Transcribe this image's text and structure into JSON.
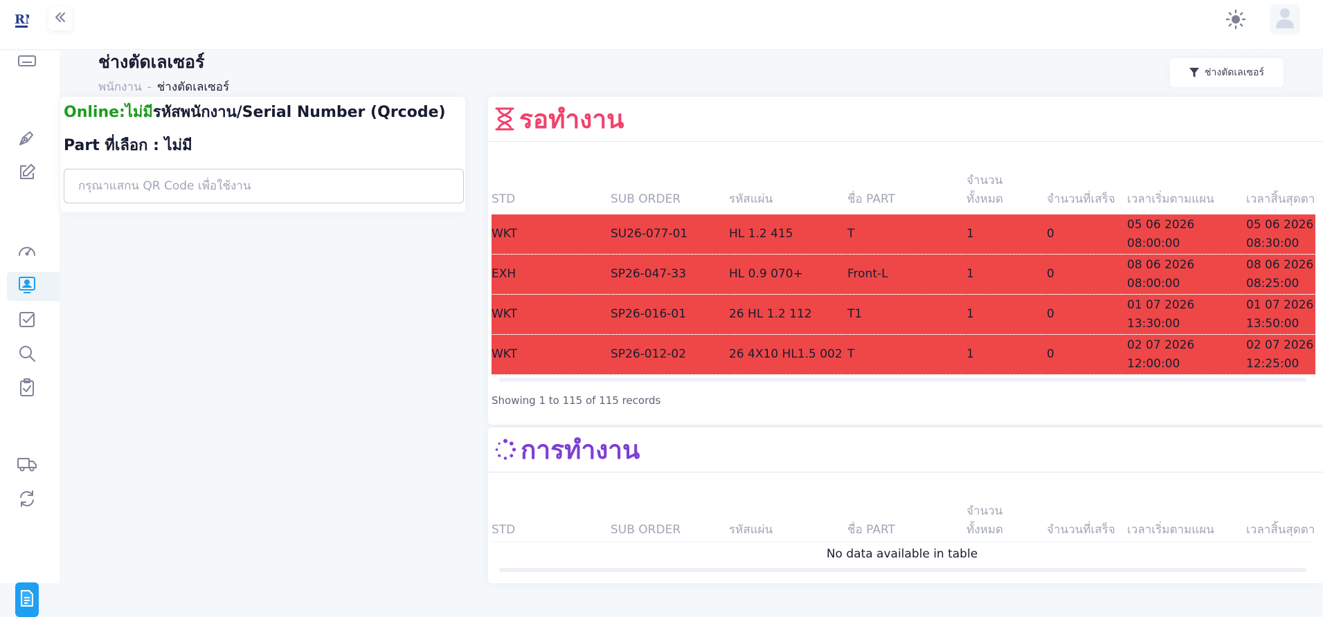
{
  "header": {
    "logo_text": "RN",
    "collapse_icon": "chevrons-left-icon",
    "theme_icon": "sun-icon",
    "user_icon": "user-avatar-icon"
  },
  "sidebar": {
    "items": [
      {
        "icon": "keyboard-icon"
      },
      {
        "icon": "pen-nib-icon"
      },
      {
        "icon": "edit-icon"
      },
      {
        "icon": "speedometer-icon"
      },
      {
        "icon": "user-monitor-icon",
        "active": true
      },
      {
        "icon": "checkbox-icon"
      },
      {
        "icon": "search-icon"
      },
      {
        "icon": "clipboard-check-icon"
      },
      {
        "icon": "truck-icon"
      },
      {
        "icon": "refresh-icon"
      }
    ],
    "bottom_icon": "document-icon"
  },
  "page": {
    "title": "ช่างตัดเลเซอร์",
    "breadcrumb": [
      "พนักงาน",
      "ช่างตัดเลเซอร์"
    ],
    "breadcrumb_sep": "-",
    "filter_label": "ช่างตัดเลเซอร์"
  },
  "scan_panel": {
    "online_label": "Online:",
    "online_value": "ไม่มี",
    "online_text": "รหัสพนักงาน/Serial Number (Qrcode)",
    "part_label": "Part ที่เลือก : ไม่มี",
    "qr_placeholder": "กรุณาแสกน QR Code เพื่อใช้งาน"
  },
  "colors": {
    "waiting": "#f1416c",
    "working": "#7e3fd3",
    "row_red": "#ef4747",
    "online_green": "#1e9c1e"
  },
  "waiting": {
    "title": "รอทำงาน",
    "icon": "hourglass-icon",
    "columns": [
      "STD",
      "SUB ORDER",
      "รหัสแผ่น",
      "ชื่อ PART",
      "จำนวน\nทั้งหมด",
      "จำนวนที่เสร็จ",
      "เวลาเริ่มตามแผน",
      "เวลาสิ้นสุดตาม"
    ],
    "rows": [
      {
        "std": "WKT",
        "sub_order": "SU26-077-01",
        "sheet": "HL 1.2 415",
        "part": "T",
        "total": "1",
        "done": "0",
        "start": "05 06 2026\n08:00:00",
        "end": "05 06 2026\n08:30:00"
      },
      {
        "std": "EXH",
        "sub_order": "SP26-047-33",
        "sheet": "HL 0.9 070+",
        "part": "Front-L",
        "total": "1",
        "done": "0",
        "start": "08 06 2026\n08:00:00",
        "end": "08 06 2026\n08:25:00"
      },
      {
        "std": "WKT",
        "sub_order": "SP26-016-01",
        "sheet": "26 HL 1.2 112",
        "part": "T1",
        "total": "1",
        "done": "0",
        "start": "01 07 2026\n13:30:00",
        "end": "01 07 2026\n13:50:00"
      },
      {
        "std": "WKT",
        "sub_order": "SP26-012-02",
        "sheet": "26 4X10 HL1.5 002",
        "part": "T",
        "total": "1",
        "done": "0",
        "start": "02 07 2026\n12:00:00",
        "end": "02 07 2026\n12:25:00"
      }
    ],
    "info": "Showing 1 to 115 of 115 records"
  },
  "working": {
    "title": "การทำงาน",
    "icon": "spinner-icon",
    "columns": [
      "STD",
      "SUB ORDER",
      "รหัสแผ่น",
      "ชื่อ PART",
      "จำนวน\nทั้งหมด",
      "จำนวนที่เสร็จ",
      "เวลาเริ่มตามแผน",
      "เวลาสิ้นสุดตาม"
    ],
    "empty_text": "No data available in table"
  }
}
